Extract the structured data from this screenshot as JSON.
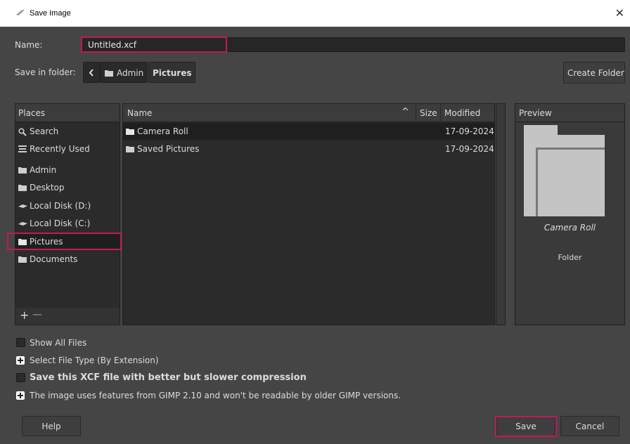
{
  "window": {
    "title": "Save Image",
    "close_glyph": "✕"
  },
  "name_row": {
    "label": "Name:",
    "value": "Untitled.xcf"
  },
  "folder_row": {
    "label": "Save in folder:",
    "crumbs": [
      "Admin",
      "Pictures"
    ],
    "create_button": "Create Folder"
  },
  "places": {
    "header": "Places",
    "items": [
      {
        "label": "Search",
        "icon": "search-icon"
      },
      {
        "label": "Recently Used",
        "icon": "recent-icon"
      },
      {
        "label": "Admin",
        "icon": "folder-icon"
      },
      {
        "label": "Desktop",
        "icon": "folder-icon"
      },
      {
        "label": "Local Disk (D:)",
        "icon": "drive-icon"
      },
      {
        "label": "Local Disk (C:)",
        "icon": "drive-icon"
      },
      {
        "label": "Pictures",
        "icon": "folder-icon"
      },
      {
        "label": "Documents",
        "icon": "folder-icon"
      }
    ],
    "selected": "Pictures",
    "add_glyph": "+",
    "remove_glyph": "—"
  },
  "files": {
    "columns": {
      "name": "Name",
      "size": "Size",
      "modified": "Modified"
    },
    "sort_glyph": "^",
    "rows": [
      {
        "name": "Camera Roll",
        "modified": "17-09-2024"
      },
      {
        "name": "Saved Pictures",
        "modified": "17-09-2024"
      }
    ],
    "selected": "Camera Roll"
  },
  "preview": {
    "header": "Preview",
    "name": "Camera Roll",
    "type": "Folder"
  },
  "options": {
    "show_all_files": "Show All Files",
    "select_file_type": "Select File Type (By Extension)",
    "compression": "Save this XCF file with better but slower compression",
    "compat_note": "The image uses features from GIMP 2.10 and won't be readable by older GIMP versions."
  },
  "buttons": {
    "help": "Help",
    "save": "Save",
    "cancel": "Cancel"
  },
  "colors": {
    "highlight": "#c2185b",
    "background": "#454545",
    "list_bg": "#2b2b2b",
    "selected_row": "#1f1f1f"
  }
}
